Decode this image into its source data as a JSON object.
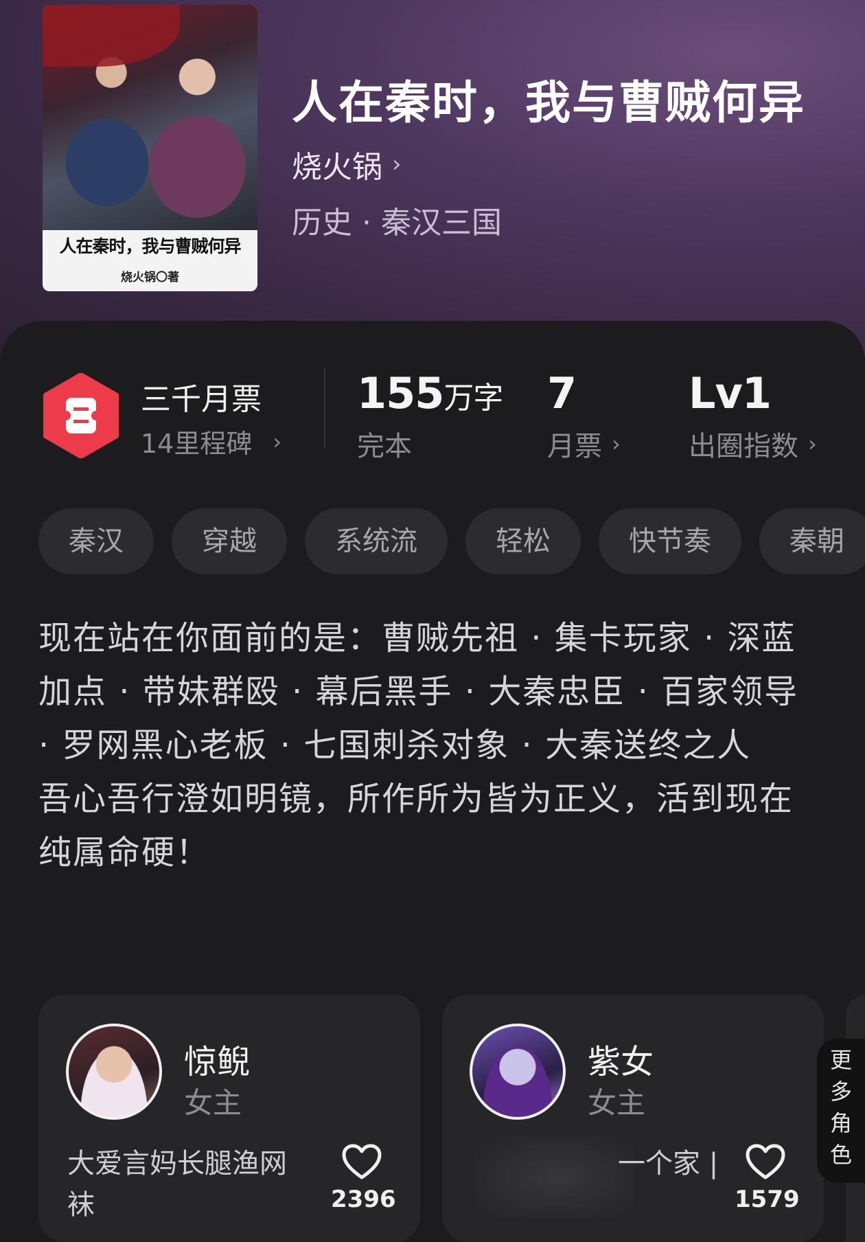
{
  "book": {
    "cover_title": "人在秦时，我与曹贼何异",
    "cover_author": "烧火锅〇著",
    "title": "人在秦时，我与曹贼何异",
    "author": "烧火锅",
    "genre": "历史 · 秦汉三国"
  },
  "stats": {
    "ticket_label": "三千月票",
    "ticket_sub": "14里程碑",
    "words_num": "155",
    "words_unit": "万字",
    "words_label": "完本",
    "votes_num": "7",
    "votes_label": "月票",
    "level_num": "Lv1",
    "level_label": "出圈指数"
  },
  "tags": [
    "秦汉",
    "穿越",
    "系统流",
    "轻松",
    "快节奏",
    "秦朝"
  ],
  "description": [
    "现在站在你面前的是：曹贼先祖 · 集卡玩家 · 深蓝加点 · 带妹群殴 · 幕后黑手 · 大秦忠臣 · 百家领导 · 罗网黑心老板 · 七国刺杀对象 · 大秦送终之人",
    "吾心吾行澄如明镜，所作所为皆为正义，活到现在纯属命硬！"
  ],
  "characters": [
    {
      "name": "惊鲵",
      "role": "女主",
      "quote": "大爱言妈长腿渔网袜",
      "likes": "2396"
    },
    {
      "name": "紫女",
      "role": "女主",
      "quote": "一个家 |",
      "likes": "1579"
    }
  ],
  "more_roles": [
    "更",
    "多",
    "角",
    "色"
  ],
  "colors": {
    "ticket_red": "#ee3b4a",
    "hero_purple": "#4f3860",
    "sheet_bg": "#1c1c1e"
  }
}
